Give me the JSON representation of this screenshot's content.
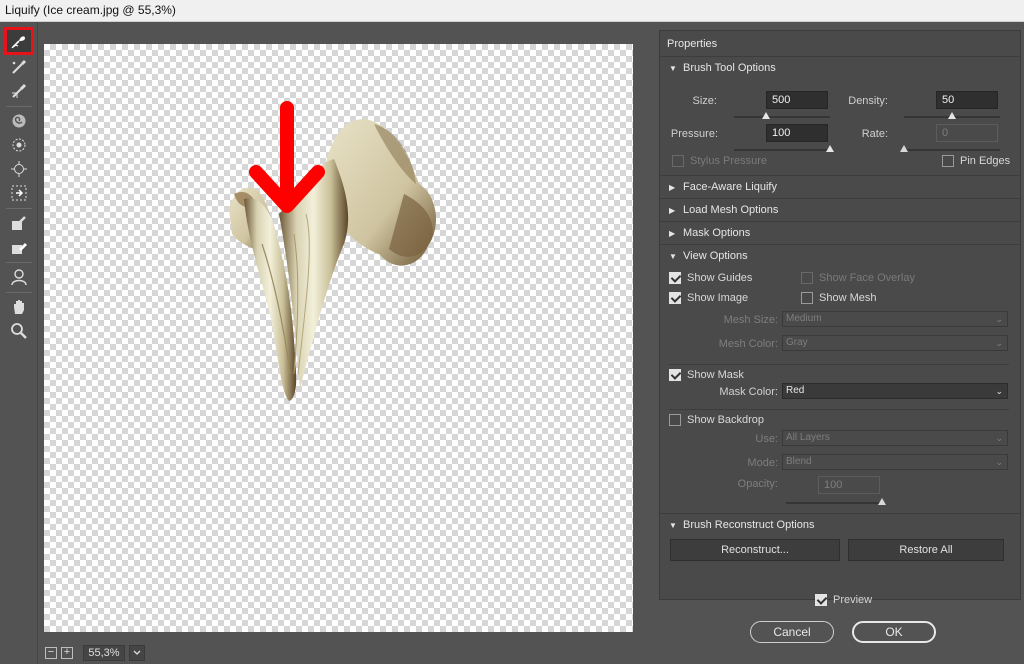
{
  "window": {
    "title": "Liquify (Ice cream.jpg @ 55,3%)"
  },
  "toolbar": {
    "tools": [
      "forward-warp-icon",
      "reconstruct-icon",
      "smooth-icon",
      "twirl-icon",
      "pucker-icon",
      "bloat-icon",
      "push-left-icon",
      "freeze-mask-icon",
      "thaw-mask-icon",
      "face-icon",
      "hand-icon",
      "zoom-icon"
    ],
    "active_tool": "forward-warp-icon",
    "highlight_color": "#e8131a"
  },
  "annotation": {
    "arrow_color": "#ff0000"
  },
  "status": {
    "zoom": "55,3%",
    "zoom_out": "−",
    "zoom_in": "+"
  },
  "properties": {
    "title": "Properties",
    "brush_tool_options": {
      "header": "Brush Tool Options",
      "size_label": "Size:",
      "size": "500",
      "size_level": 0.33,
      "density_label": "Density:",
      "density": "50",
      "density_level": 0.5,
      "pressure_label": "Pressure:",
      "pressure": "100",
      "pressure_level": 1.0,
      "rate_label": "Rate:",
      "rate": "0",
      "rate_level": 0.0,
      "stylus_pressure": "Stylus Pressure",
      "pin_edges": "Pin Edges"
    },
    "face_aware": "Face-Aware Liquify",
    "load_mesh": "Load Mesh Options",
    "mask_options": "Mask Options",
    "view_options": {
      "header": "View Options",
      "show_guides": "Show Guides",
      "show_face_overlay": "Show Face Overlay",
      "show_image": "Show Image",
      "show_mesh": "Show Mesh",
      "mesh_size_label": "Mesh Size:",
      "mesh_size": "Medium",
      "mesh_color_label": "Mesh Color:",
      "mesh_color": "Gray",
      "show_mask": "Show Mask",
      "mask_color_label": "Mask Color:",
      "mask_color": "Red",
      "show_backdrop": "Show Backdrop",
      "use_label": "Use:",
      "use": "All Layers",
      "mode_label": "Mode:",
      "mode": "Blend",
      "opacity_label": "Opacity:",
      "opacity": "100",
      "opacity_level": 1.0
    },
    "brush_reconstruct": {
      "header": "Brush Reconstruct Options",
      "reconstruct": "Reconstruct...",
      "restore_all": "Restore All"
    }
  },
  "dialog": {
    "preview": "Preview",
    "cancel": "Cancel",
    "ok": "OK"
  }
}
